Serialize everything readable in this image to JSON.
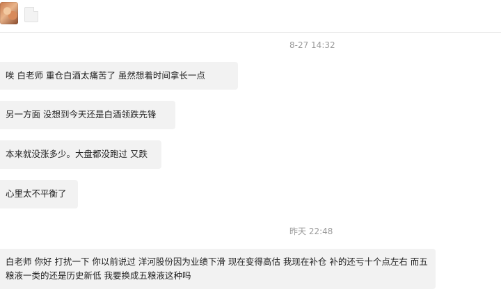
{
  "header": {
    "avatar": "contact-avatar",
    "icon": "document-icon"
  },
  "timestamps": [
    "8-27 14:32",
    "昨天 22:48"
  ],
  "messages": [
    "唉   白老师 重仓白酒太痛苦了  虽然想着时间拿长一点",
    "另一方面  没想到今天还是白酒领跌先锋",
    "本来就没涨多少。大盘都没跑过 又跌",
    "心里太不平衡了",
    "白老师 你好 打扰一下 你以前说过 洋河股份因为业绩下滑 现在变得高估 我现在补仓 补的还亏十个点左右 而五粮液一类的还是历史新低 我要换成五粮液这种吗"
  ],
  "colors": {
    "bubble": "#f2f2f2",
    "timestamp": "#9a9a9a",
    "text": "#1f1f1f"
  }
}
